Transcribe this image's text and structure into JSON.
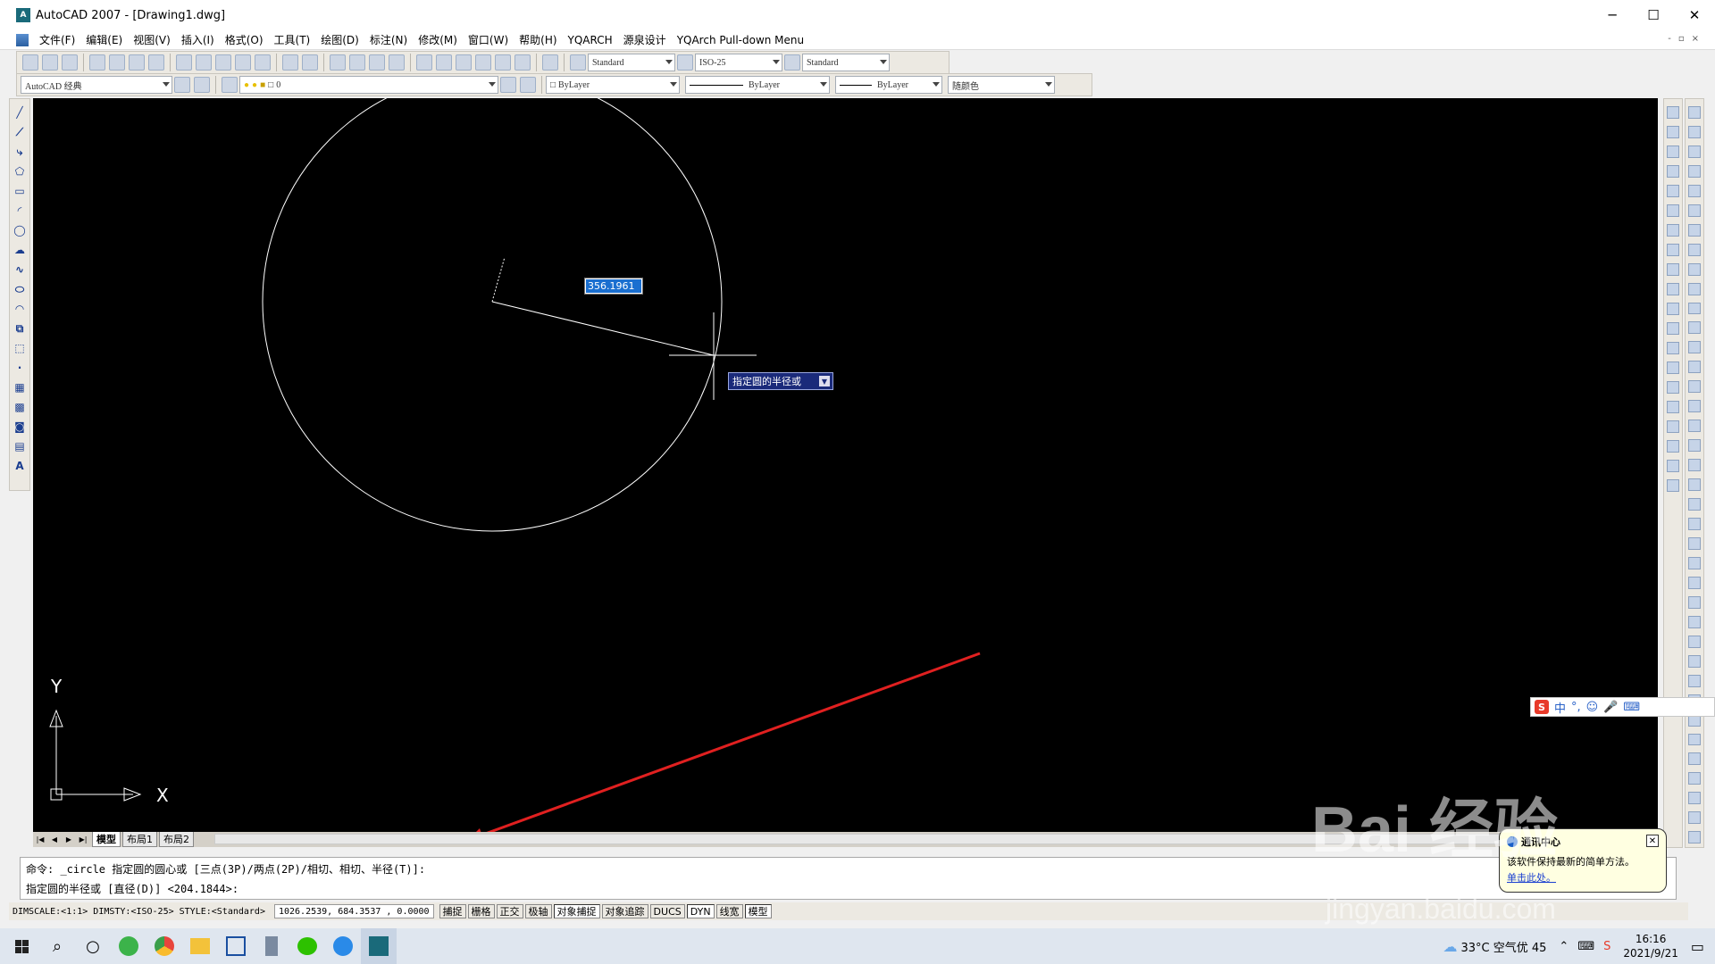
{
  "window": {
    "title": "AutoCAD 2007 - [Drawing1.dwg]",
    "app_icon": "acad-icon",
    "minimize_glyph": "─",
    "maximize_glyph": "☐",
    "close_glyph": "✕",
    "mdi_controls": [
      "-",
      "▫",
      "×"
    ]
  },
  "menus": [
    "文件(F)",
    "编辑(E)",
    "视图(V)",
    "插入(I)",
    "格式(O)",
    "工具(T)",
    "绘图(D)",
    "标注(N)",
    "修改(M)",
    "窗口(W)",
    "帮助(H)",
    "YQARCH",
    "源泉设计",
    "YQArch Pull-down Menu"
  ],
  "toolbar1": {
    "text_style": "Standard",
    "dim_style": "ISO-25",
    "table_style": "Standard"
  },
  "toolbar2": {
    "workspace": "AutoCAD 经典",
    "layer": "0",
    "color": "ByLayer",
    "linetype": "ByLayer",
    "lineweight": "ByLayer",
    "plot_style": "随颜色"
  },
  "drawing": {
    "dynamic_length": "356.1961",
    "dynamic_prompt": "指定圆的半径或",
    "prompt_icon": "down-arrow-icon",
    "ucs_x": "X",
    "ucs_y": "Y"
  },
  "layout_tabs": [
    "模型",
    "布局1",
    "布局2"
  ],
  "command": {
    "line1": "命令: _circle 指定圆的圆心或 [三点(3P)/两点(2P)/相切、相切、半径(T)]:",
    "line2": "指定圆的半径或 [直径(D)] <204.1844>:"
  },
  "status": {
    "dimscale": "DIMSCALE:<1:1> DIMSTY:<ISO-25> STYLE:<Standard>",
    "coords": "1026.2539, 684.3537 , 0.0000",
    "buttons": [
      "捕捉",
      "栅格",
      "正交",
      "极轴",
      "对象捕捉",
      "对象追踪",
      "DUCS",
      "DYN",
      "线宽",
      "模型"
    ]
  },
  "ime": {
    "label": "中",
    "items": [
      "°,",
      "☺",
      "🎤",
      "⌨"
    ]
  },
  "notification": {
    "title": "通讯中心",
    "body": "该软件保持最新的简单方法。",
    "link": "单击此处。"
  },
  "tray": {
    "weather": "33°C 空气优 45",
    "time": "16:16",
    "date": "2021/9/21"
  },
  "watermark": {
    "brand": "Bai 经验",
    "url": "jingyan.baidu.com"
  },
  "colors": {
    "canvas": "#000000",
    "annotation_arrow": "#e02020",
    "selected_text_bg": "#1a6fd0"
  }
}
